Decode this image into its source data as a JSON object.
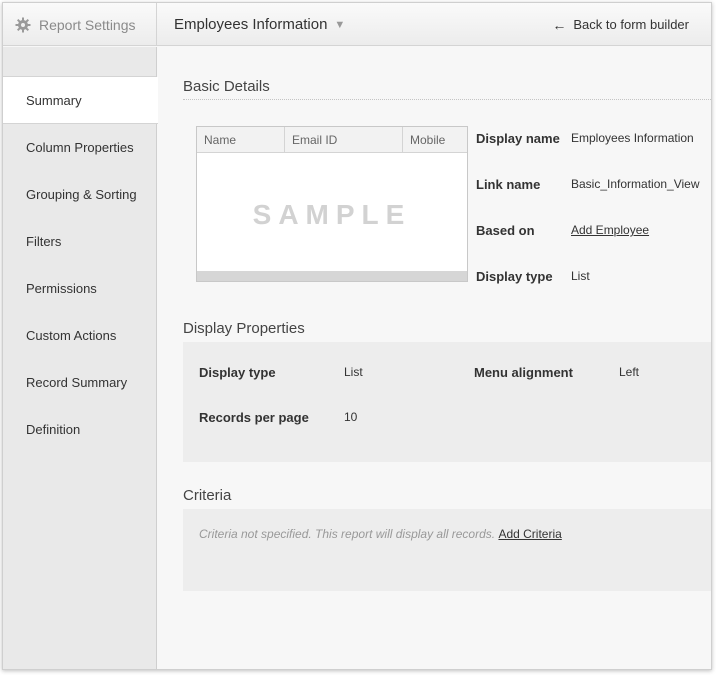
{
  "header": {
    "settings_label": "Report Settings",
    "report_title": "Employees Information",
    "back_label": "Back to form builder"
  },
  "sidebar": {
    "items": [
      {
        "label": "Summary",
        "active": true
      },
      {
        "label": "Column Properties"
      },
      {
        "label": "Grouping & Sorting"
      },
      {
        "label": "Filters"
      },
      {
        "label": "Permissions"
      },
      {
        "label": "Custom Actions"
      },
      {
        "label": "Record Summary"
      },
      {
        "label": "Definition"
      }
    ]
  },
  "basic_details": {
    "title": "Basic Details",
    "sample": {
      "columns": [
        "Name",
        "Email ID",
        "Mobile"
      ],
      "watermark": "SAMPLE"
    },
    "fields": [
      {
        "label": "Display name",
        "value": "Employees Information"
      },
      {
        "label": "Link name",
        "value": "Basic_Information_View"
      },
      {
        "label": "Based on",
        "value": "Add Employee"
      },
      {
        "label": "Display type",
        "value": "List"
      }
    ]
  },
  "display_properties": {
    "title": "Display Properties",
    "display_type_label": "Display type",
    "display_type_value": "List",
    "menu_alignment_label": "Menu alignment",
    "menu_alignment_value": "Left",
    "records_per_page_label": "Records per page",
    "records_per_page_value": "10"
  },
  "criteria": {
    "title": "Criteria",
    "message": "Criteria not specified. This report will display all records.",
    "add_link": "Add Criteria"
  },
  "icons": {
    "settings": "gear-icon",
    "title_dropdown": "chevron-down-icon",
    "back": "arrow-left-icon"
  }
}
